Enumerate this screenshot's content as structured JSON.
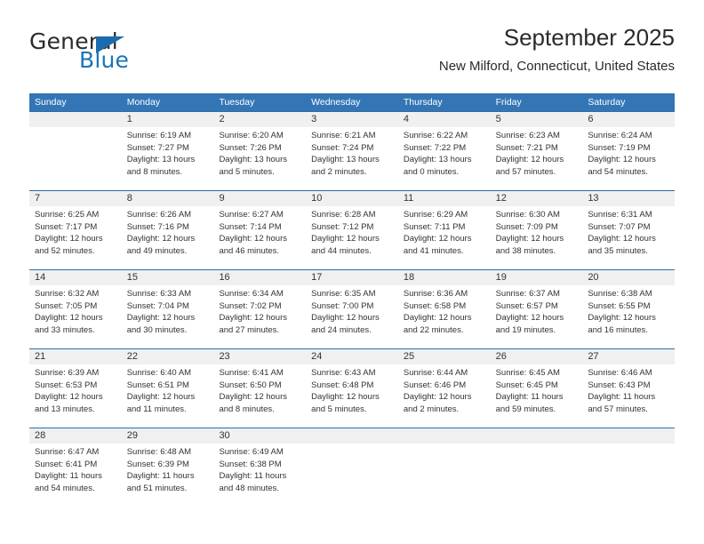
{
  "brand": {
    "name_part1": "General",
    "name_part2": "Blue",
    "accent_color": "#1b75bb"
  },
  "header": {
    "title": "September 2025",
    "subtitle": "New Milford, Connecticut, United States"
  },
  "calendar": {
    "header_color": "#3476b5",
    "daynum_band_color": "#f0f0f0",
    "weekday_headers": [
      "Sunday",
      "Monday",
      "Tuesday",
      "Wednesday",
      "Thursday",
      "Friday",
      "Saturday"
    ],
    "weeks": [
      [
        {
          "day": "",
          "sunrise": "",
          "sunset": "",
          "daylight": ""
        },
        {
          "day": "1",
          "sunrise": "Sunrise: 6:19 AM",
          "sunset": "Sunset: 7:27 PM",
          "daylight": "Daylight: 13 hours and 8 minutes."
        },
        {
          "day": "2",
          "sunrise": "Sunrise: 6:20 AM",
          "sunset": "Sunset: 7:26 PM",
          "daylight": "Daylight: 13 hours and 5 minutes."
        },
        {
          "day": "3",
          "sunrise": "Sunrise: 6:21 AM",
          "sunset": "Sunset: 7:24 PM",
          "daylight": "Daylight: 13 hours and 2 minutes."
        },
        {
          "day": "4",
          "sunrise": "Sunrise: 6:22 AM",
          "sunset": "Sunset: 7:22 PM",
          "daylight": "Daylight: 13 hours and 0 minutes."
        },
        {
          "day": "5",
          "sunrise": "Sunrise: 6:23 AM",
          "sunset": "Sunset: 7:21 PM",
          "daylight": "Daylight: 12 hours and 57 minutes."
        },
        {
          "day": "6",
          "sunrise": "Sunrise: 6:24 AM",
          "sunset": "Sunset: 7:19 PM",
          "daylight": "Daylight: 12 hours and 54 minutes."
        }
      ],
      [
        {
          "day": "7",
          "sunrise": "Sunrise: 6:25 AM",
          "sunset": "Sunset: 7:17 PM",
          "daylight": "Daylight: 12 hours and 52 minutes."
        },
        {
          "day": "8",
          "sunrise": "Sunrise: 6:26 AM",
          "sunset": "Sunset: 7:16 PM",
          "daylight": "Daylight: 12 hours and 49 minutes."
        },
        {
          "day": "9",
          "sunrise": "Sunrise: 6:27 AM",
          "sunset": "Sunset: 7:14 PM",
          "daylight": "Daylight: 12 hours and 46 minutes."
        },
        {
          "day": "10",
          "sunrise": "Sunrise: 6:28 AM",
          "sunset": "Sunset: 7:12 PM",
          "daylight": "Daylight: 12 hours and 44 minutes."
        },
        {
          "day": "11",
          "sunrise": "Sunrise: 6:29 AM",
          "sunset": "Sunset: 7:11 PM",
          "daylight": "Daylight: 12 hours and 41 minutes."
        },
        {
          "day": "12",
          "sunrise": "Sunrise: 6:30 AM",
          "sunset": "Sunset: 7:09 PM",
          "daylight": "Daylight: 12 hours and 38 minutes."
        },
        {
          "day": "13",
          "sunrise": "Sunrise: 6:31 AM",
          "sunset": "Sunset: 7:07 PM",
          "daylight": "Daylight: 12 hours and 35 minutes."
        }
      ],
      [
        {
          "day": "14",
          "sunrise": "Sunrise: 6:32 AM",
          "sunset": "Sunset: 7:05 PM",
          "daylight": "Daylight: 12 hours and 33 minutes."
        },
        {
          "day": "15",
          "sunrise": "Sunrise: 6:33 AM",
          "sunset": "Sunset: 7:04 PM",
          "daylight": "Daylight: 12 hours and 30 minutes."
        },
        {
          "day": "16",
          "sunrise": "Sunrise: 6:34 AM",
          "sunset": "Sunset: 7:02 PM",
          "daylight": "Daylight: 12 hours and 27 minutes."
        },
        {
          "day": "17",
          "sunrise": "Sunrise: 6:35 AM",
          "sunset": "Sunset: 7:00 PM",
          "daylight": "Daylight: 12 hours and 24 minutes."
        },
        {
          "day": "18",
          "sunrise": "Sunrise: 6:36 AM",
          "sunset": "Sunset: 6:58 PM",
          "daylight": "Daylight: 12 hours and 22 minutes."
        },
        {
          "day": "19",
          "sunrise": "Sunrise: 6:37 AM",
          "sunset": "Sunset: 6:57 PM",
          "daylight": "Daylight: 12 hours and 19 minutes."
        },
        {
          "day": "20",
          "sunrise": "Sunrise: 6:38 AM",
          "sunset": "Sunset: 6:55 PM",
          "daylight": "Daylight: 12 hours and 16 minutes."
        }
      ],
      [
        {
          "day": "21",
          "sunrise": "Sunrise: 6:39 AM",
          "sunset": "Sunset: 6:53 PM",
          "daylight": "Daylight: 12 hours and 13 minutes."
        },
        {
          "day": "22",
          "sunrise": "Sunrise: 6:40 AM",
          "sunset": "Sunset: 6:51 PM",
          "daylight": "Daylight: 12 hours and 11 minutes."
        },
        {
          "day": "23",
          "sunrise": "Sunrise: 6:41 AM",
          "sunset": "Sunset: 6:50 PM",
          "daylight": "Daylight: 12 hours and 8 minutes."
        },
        {
          "day": "24",
          "sunrise": "Sunrise: 6:43 AM",
          "sunset": "Sunset: 6:48 PM",
          "daylight": "Daylight: 12 hours and 5 minutes."
        },
        {
          "day": "25",
          "sunrise": "Sunrise: 6:44 AM",
          "sunset": "Sunset: 6:46 PM",
          "daylight": "Daylight: 12 hours and 2 minutes."
        },
        {
          "day": "26",
          "sunrise": "Sunrise: 6:45 AM",
          "sunset": "Sunset: 6:45 PM",
          "daylight": "Daylight: 11 hours and 59 minutes."
        },
        {
          "day": "27",
          "sunrise": "Sunrise: 6:46 AM",
          "sunset": "Sunset: 6:43 PM",
          "daylight": "Daylight: 11 hours and 57 minutes."
        }
      ],
      [
        {
          "day": "28",
          "sunrise": "Sunrise: 6:47 AM",
          "sunset": "Sunset: 6:41 PM",
          "daylight": "Daylight: 11 hours and 54 minutes."
        },
        {
          "day": "29",
          "sunrise": "Sunrise: 6:48 AM",
          "sunset": "Sunset: 6:39 PM",
          "daylight": "Daylight: 11 hours and 51 minutes."
        },
        {
          "day": "30",
          "sunrise": "Sunrise: 6:49 AM",
          "sunset": "Sunset: 6:38 PM",
          "daylight": "Daylight: 11 hours and 48 minutes."
        },
        {
          "day": "",
          "sunrise": "",
          "sunset": "",
          "daylight": ""
        },
        {
          "day": "",
          "sunrise": "",
          "sunset": "",
          "daylight": ""
        },
        {
          "day": "",
          "sunrise": "",
          "sunset": "",
          "daylight": ""
        },
        {
          "day": "",
          "sunrise": "",
          "sunset": "",
          "daylight": ""
        }
      ]
    ]
  }
}
